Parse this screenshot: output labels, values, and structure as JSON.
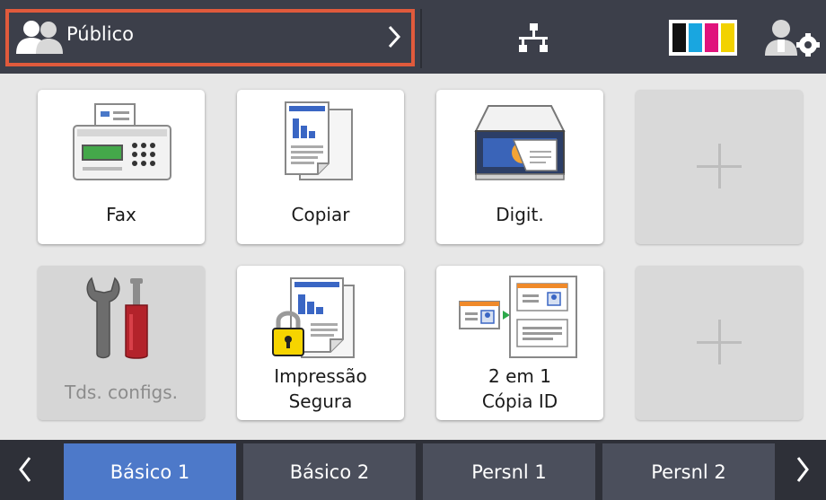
{
  "header": {
    "user_label": "Público",
    "toner_colors": [
      "#111111",
      "#19a6e0",
      "#e0137c",
      "#f2d200"
    ],
    "icons": [
      "users-icon",
      "chevron-right-icon",
      "network-icon",
      "toner-icon",
      "admin-settings-icon"
    ]
  },
  "tiles": {
    "fax": "Fax",
    "copy": "Copiar",
    "scan": "Digit.",
    "settings": "Tds. configs.",
    "secure_print_line1": "Impressão",
    "secure_print_line2": "Segura",
    "id_copy_line1": "2 em 1",
    "id_copy_line2": "Cópia ID"
  },
  "tabs": [
    "Básico 1",
    "Básico 2",
    "Persnl 1",
    "Persnl 2"
  ],
  "active_tab": "Básico 1",
  "colors": {
    "header_bg": "#3c3f4a",
    "highlight_border": "#e05a3c",
    "active_tab": "#4d79c9"
  }
}
